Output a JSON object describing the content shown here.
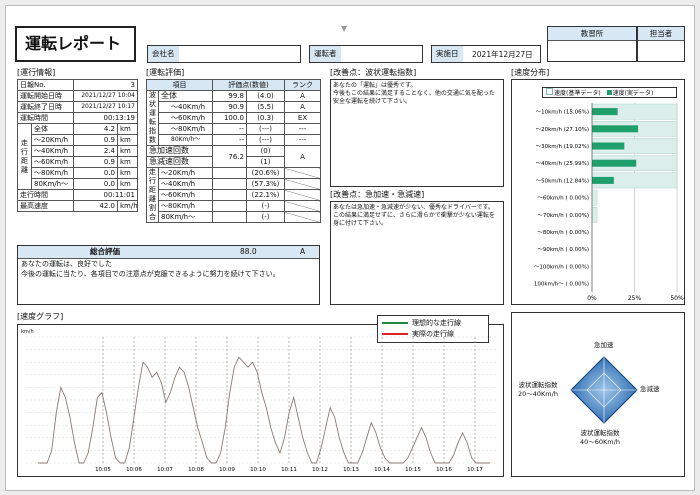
{
  "title": "運転レポート",
  "header": {
    "company_label": "会社名",
    "company_value": "",
    "driver_label": "運転者",
    "driver_value": "",
    "date_label": "実施日",
    "date_value": "2021年12月27日",
    "school_label": "教習所",
    "school_value": "",
    "instructor_label": "担当者",
    "instructor_value": ""
  },
  "operation": {
    "heading": "[運行情報]",
    "rows": [
      {
        "label": "日報No.",
        "value": "3",
        "unit": ""
      },
      {
        "label": "運転開始日時",
        "value": "2021/12/27 10:04",
        "unit": ""
      },
      {
        "label": "運転終了日時",
        "value": "2021/12/27 10:17",
        "unit": ""
      },
      {
        "label": "運転時間",
        "value": "00:13:19",
        "unit": ""
      }
    ],
    "distance_group": "走行距離",
    "distance_rows": [
      {
        "label": "全体",
        "value": "4.2",
        "unit": "km"
      },
      {
        "label": "〜20Km/h",
        "value": "0.9",
        "unit": "km"
      },
      {
        "label": "〜40Km/h",
        "value": "2.4",
        "unit": "km"
      },
      {
        "label": "〜60Km/h",
        "value": "0.9",
        "unit": "km"
      },
      {
        "label": "〜80Km/h",
        "value": "0.0",
        "unit": "km"
      },
      {
        "label": "80Km/h〜",
        "value": "0.0",
        "unit": "km"
      }
    ],
    "tail_rows": [
      {
        "label": "走行時間",
        "value": "00:11:01",
        "unit": ""
      },
      {
        "label": "最高速度",
        "value": "42.0",
        "unit": "km/h"
      }
    ]
  },
  "evaluation": {
    "heading": "[運転評価]",
    "col_item": "項目",
    "col_score": "評価点(数値)",
    "col_rank": "ランク",
    "wave_group": "波状運転指数",
    "wave_rows": [
      {
        "label": "全体",
        "score": "99.8",
        "num": "(4.0)",
        "rank": "A"
      },
      {
        "label": "〜40Km/h",
        "score": "90.9",
        "num": "(5.5)",
        "rank": "A"
      },
      {
        "label": "〜60Km/h",
        "score": "100.0",
        "num": "(0.3)",
        "rank": "EX"
      },
      {
        "label": "〜80Km/h",
        "score": "--",
        "num": "(---)",
        "rank": "---"
      },
      {
        "label": "80Km/h〜",
        "score": "--",
        "num": "(---)",
        "rank": "---"
      }
    ],
    "accel_label": "急加速回数",
    "accel_num": "(0)",
    "decel_label": "急減速回数",
    "decel_num": "(1)",
    "accel_score": "76.2",
    "accel_rank": "A",
    "ratio_group": "走行距離割合",
    "ratio_rows": [
      {
        "label": "〜20Km/h",
        "value": "(20.6%)"
      },
      {
        "label": "〜40Km/h",
        "value": "(57.3%)"
      },
      {
        "label": "〜60Km/h",
        "value": "(22.1%)"
      },
      {
        "label": "〜80Km/h",
        "value": "(-)"
      },
      {
        "label": "80Km/h〜",
        "value": "(-)"
      }
    ]
  },
  "improve_wave": {
    "heading": "[改善点：波状運転指数]",
    "lines": [
      "あなたの「運転」は優秀です。",
      "今後もこの結果に満足することなく、他の交通に気を配った",
      "安全な運転を続けて下さい。"
    ]
  },
  "improve_accel": {
    "heading": "[改善点：急加速・急減速]",
    "lines": [
      "あなたは急加速・急減速が少ない、優秀なドライバーです。",
      "この結果に満足せずに、さらに滑らかで衝撃が少ない運転を",
      "身に付けて下さい。"
    ]
  },
  "overall": {
    "label": "総合評価",
    "score": "88.0",
    "rank": "A",
    "lines": [
      "あなたの運転は、良好でした",
      "今後の運転に当たり、各項目での注意点が克服できるように努力を続けて下さい。"
    ]
  },
  "speed_dist": {
    "heading": "[速度分布]",
    "legend_ref": "速度(基準データ)",
    "legend_act": "速度(実データ)",
    "x_ticks": [
      "0%",
      "25%",
      "50%"
    ],
    "categories": [
      "〜10km/h (15.06%)",
      "〜20km/h (27.10%)",
      "〜30km/h (19.02%)",
      "〜40km/h (25.99%)",
      "〜50km/h (12.84%)",
      "〜60km/h ( 0.00%)",
      "〜70km/h ( 0.00%)",
      "〜80km/h ( 0.00%)",
      "〜90km/h ( 0.00%)",
      "〜100km/h ( 0.00%)",
      "100km/h〜 ( 0.00%)"
    ]
  },
  "speed_graph": {
    "heading": "[速度グラフ]",
    "unit": "km/h",
    "legend_ideal": "理想的な走行線",
    "legend_actual": "実際の走行線",
    "time_labels": [
      "10:05",
      "10:06",
      "10:07",
      "10:08",
      "10:09",
      "10:10",
      "10:11",
      "10:12",
      "10:13",
      "10:14",
      "10:15",
      "10:16",
      "10:17"
    ]
  },
  "radar": {
    "top": "急加速",
    "right": "急減速",
    "left_line1": "波状運転指数",
    "left_line2": "20〜40Km/h",
    "bottom_line1": "波状運転指数",
    "bottom_line2": "40〜60Km/h"
  },
  "chart_data": [
    {
      "type": "bar",
      "title": "速度分布",
      "categories": [
        "〜10km/h",
        "〜20km/h",
        "〜30km/h",
        "〜40km/h",
        "〜50km/h",
        "〜60km/h",
        "〜70km/h",
        "〜80km/h",
        "〜90km/h",
        "〜100km/h",
        "100km/h〜"
      ],
      "xlim": [
        0,
        50
      ],
      "series": [
        {
          "name": "速度(基準データ)",
          "values": [
            50,
            50,
            50,
            50,
            50,
            3,
            3,
            0,
            0,
            0,
            0
          ]
        },
        {
          "name": "速度(実データ)",
          "values": [
            15.06,
            27.1,
            19.02,
            25.99,
            12.84,
            0,
            0,
            0,
            0,
            0,
            0
          ]
        }
      ]
    },
    {
      "type": "line",
      "title": "速度グラフ",
      "ylabel": "km/h",
      "series": [
        {
          "name": "実際の走行線",
          "color": "#8a7a72",
          "values": [
            0,
            0,
            0,
            5,
            20,
            30,
            26,
            18,
            8,
            0,
            0,
            4,
            14,
            26,
            28,
            20,
            10,
            2,
            0,
            0,
            6,
            18,
            30,
            40,
            38,
            34,
            36,
            32,
            24,
            28,
            34,
            38,
            36,
            30,
            22,
            14,
            8,
            2,
            0,
            0,
            4,
            14,
            28,
            38,
            42,
            40,
            38,
            40,
            36,
            28,
            22,
            14,
            8,
            4,
            10,
            20,
            26,
            18,
            10,
            4,
            0,
            0,
            6,
            14,
            22,
            18,
            10,
            4,
            0,
            0,
            0,
            4,
            10,
            16,
            12,
            6,
            2,
            0,
            0,
            0,
            0,
            2,
            6,
            10,
            14,
            10,
            4,
            0,
            0,
            0,
            0,
            3,
            8,
            12,
            8,
            2,
            0,
            0,
            0,
            0
          ]
        }
      ]
    }
  ]
}
